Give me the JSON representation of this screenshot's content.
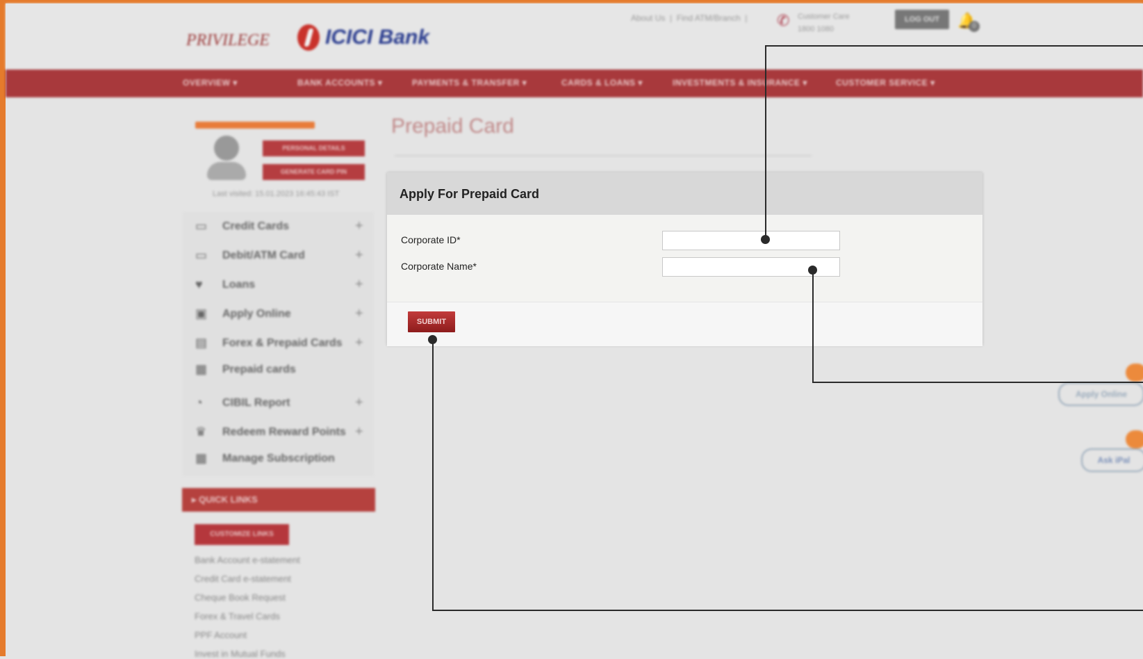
{
  "header": {
    "privilege_logo": "PRIVILEGE",
    "bank_name": "ICICI Bank",
    "top_links": [
      "About Us",
      "Find ATM/Branch"
    ],
    "customer_care_label": "Customer Care",
    "customer_care_number": "1800 1080",
    "logout_label": "LOG OUT",
    "notification_count": "0"
  },
  "nav": {
    "items": [
      "OVERVIEW ▾",
      "BANK ACCOUNTS ▾",
      "PAYMENTS & TRANSFER ▾",
      "CARDS & LOANS ▾",
      "INVESTMENTS & INSURANCE ▾",
      "CUSTOMER SERVICE ▾"
    ]
  },
  "profile": {
    "personal_details_label": "PERSONAL DETAILS",
    "generate_pin_label": "GENERATE CARD PIN",
    "last_visited": "Last visited: 15.01.2023 16:45:43 IST"
  },
  "sidebar": {
    "items": [
      {
        "label": "Credit Cards",
        "icon": "card-icon",
        "glyph": "▭",
        "expandable": true
      },
      {
        "label": "Debit/ATM Card",
        "icon": "card-icon",
        "glyph": "▭",
        "expandable": true
      },
      {
        "label": "Loans",
        "icon": "handshake-icon",
        "glyph": "♥",
        "expandable": true
      },
      {
        "label": "Apply Online",
        "icon": "monitor-icon",
        "glyph": "▣",
        "expandable": true
      },
      {
        "label": "Forex & Prepaid Cards",
        "icon": "forex-icon",
        "glyph": "▤",
        "expandable": true
      },
      {
        "label": "Prepaid cards",
        "icon": "prepaid-card-icon",
        "glyph": "▦",
        "expandable": false
      },
      {
        "label": "CIBIL Report",
        "icon": "report-icon",
        "glyph": "◔",
        "expandable": true
      },
      {
        "label": "Redeem Reward Points",
        "icon": "trophy-icon",
        "glyph": "♛",
        "expandable": true
      },
      {
        "label": "Manage Subscription",
        "icon": "subscription-icon",
        "glyph": "▦",
        "expandable": false
      }
    ]
  },
  "quick_links": {
    "title": "QUICK LINKS",
    "customize_label": "CUSTOMIZE LINKS",
    "links": [
      "Bank Account e-statement",
      "Credit Card e-statement",
      "Cheque Book Request",
      "Forex & Travel Cards",
      "PPF Account",
      "Invest in Mutual Funds"
    ]
  },
  "page": {
    "title": "Prepaid Card"
  },
  "form": {
    "title": "Apply For Prepaid Card",
    "corporate_id_label": "Corporate ID*",
    "corporate_id_value": "",
    "corporate_name_label": "Corporate Name*",
    "corporate_name_value": "",
    "submit_label": "SUBMIT"
  },
  "floating": {
    "apply_online_label": "Apply Online",
    "ipal_label": "Ask iPal"
  },
  "colors": {
    "frame": "#e57b2c",
    "nav_bar": "#a8393c",
    "submit_button": "#a32828",
    "callout_line": "#2a2a2a"
  }
}
